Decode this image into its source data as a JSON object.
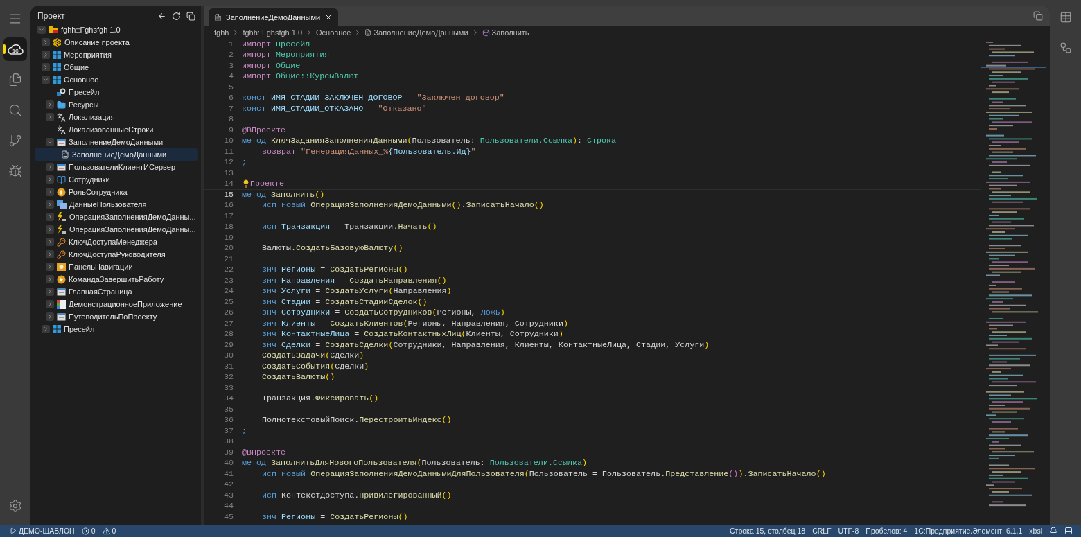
{
  "activity_bar": {
    "items": [
      {
        "kind": "menu",
        "selected": false
      },
      {
        "kind": "cloud",
        "logo_text": "1С",
        "selected": true
      },
      {
        "kind": "files",
        "selected": false
      },
      {
        "kind": "search",
        "selected": false
      },
      {
        "kind": "branch",
        "selected": false
      },
      {
        "kind": "debug",
        "selected": false
      }
    ],
    "bottom": [
      {
        "kind": "settings"
      }
    ]
  },
  "sidebar": {
    "title": "Проект",
    "tree": [
      {
        "label": "fghh::Fghsfgh 1.0",
        "kind": "project",
        "expanded": true,
        "selected": false,
        "children": [
          {
            "label": "Описание проекта",
            "kind": "gear",
            "expanded": false,
            "selected": false
          },
          {
            "label": "Мероприятия",
            "kind": "grid",
            "expanded": false,
            "selected": false
          },
          {
            "label": "Общие",
            "kind": "grid",
            "expanded": false,
            "selected": false
          },
          {
            "label": "Основное",
            "kind": "grid",
            "expanded": true,
            "selected": false,
            "children": [
              {
                "label": "Пресейл",
                "kind": "service",
                "selected": false
              },
              {
                "label": "Ресурсы",
                "kind": "folder",
                "expanded": false,
                "selected": false
              },
              {
                "label": "Локализация",
                "kind": "translate",
                "expanded": false,
                "selected": false
              },
              {
                "label": "ЛокализованныеСтроки",
                "kind": "translate",
                "selected": false
              },
              {
                "label": "ЗаполнениеДемоДанными",
                "kind": "form",
                "expanded": true,
                "selected": false,
                "children": [
                  {
                    "label": "ЗаполнениеДемоДанными",
                    "kind": "doc",
                    "selected": true
                  }
                ]
              },
              {
                "label": "ПользователиКлиентИСервер",
                "kind": "form",
                "expanded": false,
                "selected": false
              },
              {
                "label": "Сотрудники",
                "kind": "book",
                "expanded": false,
                "selected": false
              },
              {
                "label": "РольСотрудника",
                "kind": "coin",
                "expanded": false,
                "selected": false
              },
              {
                "label": "ДанныеПользователя",
                "kind": "table",
                "expanded": false,
                "selected": false
              },
              {
                "label": "ОперацияЗаполненияДемоДанны...",
                "kind": "log",
                "expanded": false,
                "selected": false
              },
              {
                "label": "ОперацияЗаполненияДемоДанны...",
                "kind": "log",
                "expanded": false,
                "selected": false
              },
              {
                "label": "КлючДоступаМенеджера",
                "kind": "key",
                "expanded": false,
                "selected": false
              },
              {
                "label": "КлючДоступаРуководителя",
                "kind": "key",
                "expanded": false,
                "selected": false
              },
              {
                "label": "ПанельНавигации",
                "kind": "nav",
                "expanded": false,
                "selected": false
              },
              {
                "label": "КомандаЗавершитьРаботу",
                "kind": "play",
                "expanded": false,
                "selected": false
              },
              {
                "label": "ГлавнаяСтраница",
                "kind": "page",
                "expanded": false,
                "selected": false
              },
              {
                "label": "ДемонстрационноеПриложение",
                "kind": "app",
                "expanded": false,
                "selected": false
              },
              {
                "label": "ПутеводительПоПроекту",
                "kind": "page",
                "expanded": false,
                "selected": false
              }
            ]
          },
          {
            "label": "Пресейл",
            "kind": "grid",
            "expanded": false,
            "selected": false
          }
        ]
      }
    ]
  },
  "editor": {
    "tabs": [
      {
        "label": "ЗаполнениеДемоДанными",
        "selected": true
      }
    ],
    "breadcrumbs": [
      {
        "label": "fghh",
        "kind": "text"
      },
      {
        "label": "fghh::Fghsfgh 1.0",
        "kind": "text"
      },
      {
        "label": "Основное",
        "kind": "text"
      },
      {
        "label": "ЗаполнениеДемоДанными",
        "kind": "doc"
      },
      {
        "label": "Заполнить",
        "kind": "method"
      }
    ],
    "lines": [
      {
        "n": "1",
        "tokens": [
          {
            "kind": "imp",
            "text": "импорт "
          },
          {
            "kind": "mod",
            "text": "Пресейл"
          }
        ]
      },
      {
        "n": "2",
        "tokens": [
          {
            "kind": "imp",
            "text": "импорт "
          },
          {
            "kind": "mod",
            "text": "Мероприятия"
          }
        ]
      },
      {
        "n": "3",
        "tokens": [
          {
            "kind": "imp",
            "text": "импорт "
          },
          {
            "kind": "mod",
            "text": "Общие"
          }
        ]
      },
      {
        "n": "4",
        "tokens": [
          {
            "kind": "imp",
            "text": "импорт "
          },
          {
            "kind": "mod",
            "text": "Общие::КурсыВалют"
          }
        ]
      },
      {
        "n": "5"
      },
      {
        "n": "6",
        "tokens": [
          {
            "kind": "kw",
            "text": "конст "
          },
          {
            "kind": "var",
            "text": "ИМЯ_СТАДИИ_ЗАКЛЮЧЕН_ДОГОВОР"
          },
          {
            "kind": "p",
            "text": " = "
          },
          {
            "kind": "str",
            "text": "\"Заключен договор\""
          }
        ]
      },
      {
        "n": "7",
        "tokens": [
          {
            "kind": "kw",
            "text": "конст "
          },
          {
            "kind": "var",
            "text": "ИМЯ_СТАДИИ_ОТКАЗАНО"
          },
          {
            "kind": "p",
            "text": " = "
          },
          {
            "kind": "str",
            "text": "\"Отказано\""
          }
        ]
      },
      {
        "n": "8"
      },
      {
        "n": "9",
        "tokens": [
          {
            "kind": "imp",
            "text": "@ВПроекте"
          }
        ]
      },
      {
        "n": "10",
        "tokens": [
          {
            "kind": "kw",
            "text": "метод "
          },
          {
            "kind": "fn",
            "text": "КлючЗаданияЗаполненияДанными"
          },
          {
            "kind": "br",
            "text": "("
          },
          {
            "kind": "p",
            "text": "Пользователь: "
          },
          {
            "kind": "mod",
            "text": "Пользователи.Ссылка"
          },
          {
            "kind": "br",
            "text": ")"
          },
          {
            "kind": "p",
            "text": ": "
          },
          {
            "kind": "mod",
            "text": "Строка"
          }
        ]
      },
      {
        "n": "11",
        "indented": true,
        "tokens": [
          {
            "kind": "imp",
            "text": "возврат "
          },
          {
            "kind": "str",
            "text": "\"ГенерацияДанных_%"
          },
          {
            "kind": "var",
            "text": "{Пользователь.Ид}"
          },
          {
            "kind": "str",
            "text": "\""
          }
        ]
      },
      {
        "n": "12",
        "tokens": [
          {
            "kind": "kw",
            "text": ";"
          }
        ]
      },
      {
        "n": "13"
      },
      {
        "n": "14",
        "bulb": true,
        "tokens": [
          {
            "kind": "imp",
            "text": "Проекте"
          }
        ]
      },
      {
        "n": "15",
        "current": true,
        "tokens": [
          {
            "kind": "kw",
            "text": "метод "
          },
          {
            "kind": "fn",
            "text": "Заполнить"
          },
          {
            "kind": "br",
            "text": "()"
          }
        ]
      },
      {
        "n": "16",
        "indented": true,
        "tokens": [
          {
            "kind": "kw",
            "text": "исп "
          },
          {
            "kind": "kw",
            "text": "новый "
          },
          {
            "kind": "fn",
            "text": "ОперацияЗаполненияДемоДанными"
          },
          {
            "kind": "br",
            "text": "()"
          },
          {
            "kind": "p",
            "text": "."
          },
          {
            "kind": "fn",
            "text": "ЗаписатьНачало"
          },
          {
            "kind": "br",
            "text": "()"
          }
        ]
      },
      {
        "n": "17",
        "indented": true
      },
      {
        "n": "18",
        "indented": true,
        "tokens": [
          {
            "kind": "kw",
            "text": "исп "
          },
          {
            "kind": "var",
            "text": "Транзакция"
          },
          {
            "kind": "p",
            "text": " = Транзакции."
          },
          {
            "kind": "fn",
            "text": "Начать"
          },
          {
            "kind": "br",
            "text": "()"
          }
        ]
      },
      {
        "n": "19",
        "indented": true
      },
      {
        "n": "20",
        "indented": true,
        "tokens": [
          {
            "kind": "p",
            "text": "Валюты."
          },
          {
            "kind": "fn",
            "text": "СоздатьБазовуюВалюту"
          },
          {
            "kind": "br",
            "text": "()"
          }
        ]
      },
      {
        "n": "21",
        "indented": true
      },
      {
        "n": "22",
        "indented": true,
        "tokens": [
          {
            "kind": "kw",
            "text": "знч "
          },
          {
            "kind": "var",
            "text": "Регионы"
          },
          {
            "kind": "p",
            "text": " = "
          },
          {
            "kind": "fn",
            "text": "СоздатьРегионы"
          },
          {
            "kind": "br",
            "text": "()"
          }
        ]
      },
      {
        "n": "23",
        "indented": true,
        "tokens": [
          {
            "kind": "kw",
            "text": "знч "
          },
          {
            "kind": "var",
            "text": "Направления"
          },
          {
            "kind": "p",
            "text": " = "
          },
          {
            "kind": "fn",
            "text": "СоздатьНаправления"
          },
          {
            "kind": "br",
            "text": "()"
          }
        ]
      },
      {
        "n": "24",
        "indented": true,
        "tokens": [
          {
            "kind": "kw",
            "text": "знч "
          },
          {
            "kind": "var",
            "text": "Услуги"
          },
          {
            "kind": "p",
            "text": " = "
          },
          {
            "kind": "fn",
            "text": "СоздатьУслуги"
          },
          {
            "kind": "br",
            "text": "("
          },
          {
            "kind": "p",
            "text": "Направления"
          },
          {
            "kind": "br",
            "text": ")"
          }
        ]
      },
      {
        "n": "25",
        "indented": true,
        "tokens": [
          {
            "kind": "kw",
            "text": "знч "
          },
          {
            "kind": "var",
            "text": "Стадии"
          },
          {
            "kind": "p",
            "text": " = "
          },
          {
            "kind": "fn",
            "text": "СоздатьСтадииСделок"
          },
          {
            "kind": "br",
            "text": "()"
          }
        ]
      },
      {
        "n": "26",
        "indented": true,
        "tokens": [
          {
            "kind": "kw",
            "text": "знч "
          },
          {
            "kind": "var",
            "text": "Сотрудники"
          },
          {
            "kind": "p",
            "text": " = "
          },
          {
            "kind": "fn",
            "text": "СоздатьСотрудников"
          },
          {
            "kind": "br",
            "text": "("
          },
          {
            "kind": "p",
            "text": "Регионы, "
          },
          {
            "kind": "kw",
            "text": "Ложь"
          },
          {
            "kind": "br",
            "text": ")"
          }
        ]
      },
      {
        "n": "27",
        "indented": true,
        "tokens": [
          {
            "kind": "kw",
            "text": "знч "
          },
          {
            "kind": "var",
            "text": "Клиенты"
          },
          {
            "kind": "p",
            "text": " = "
          },
          {
            "kind": "fn",
            "text": "СоздатьКлиентов"
          },
          {
            "kind": "br",
            "text": "("
          },
          {
            "kind": "p",
            "text": "Регионы, Направления, Сотрудники"
          },
          {
            "kind": "br",
            "text": ")"
          }
        ]
      },
      {
        "n": "28",
        "indented": true,
        "tokens": [
          {
            "kind": "kw",
            "text": "знч "
          },
          {
            "kind": "var",
            "text": "КонтактныеЛица"
          },
          {
            "kind": "p",
            "text": " = "
          },
          {
            "kind": "fn",
            "text": "СоздатьКонтактныхЛиц"
          },
          {
            "kind": "br",
            "text": "("
          },
          {
            "kind": "p",
            "text": "Клиенты, Сотрудники"
          },
          {
            "kind": "br",
            "text": ")"
          }
        ]
      },
      {
        "n": "29",
        "indented": true,
        "tokens": [
          {
            "kind": "kw",
            "text": "знч "
          },
          {
            "kind": "var",
            "text": "Сделки"
          },
          {
            "kind": "p",
            "text": " = "
          },
          {
            "kind": "fn",
            "text": "СоздатьСделки"
          },
          {
            "kind": "br",
            "text": "("
          },
          {
            "kind": "p",
            "text": "Сотрудники, Направления, Клиенты, КонтактныеЛица, Стадии, Услуги"
          },
          {
            "kind": "br",
            "text": ")"
          }
        ]
      },
      {
        "n": "30",
        "indented": true,
        "tokens": [
          {
            "kind": "fn",
            "text": "СоздатьЗадачи"
          },
          {
            "kind": "br",
            "text": "("
          },
          {
            "kind": "p",
            "text": "Сделки"
          },
          {
            "kind": "br",
            "text": ")"
          }
        ]
      },
      {
        "n": "31",
        "indented": true,
        "tokens": [
          {
            "kind": "fn",
            "text": "СоздатьСобытия"
          },
          {
            "kind": "br",
            "text": "("
          },
          {
            "kind": "p",
            "text": "Сделки"
          },
          {
            "kind": "br",
            "text": ")"
          }
        ]
      },
      {
        "n": "32",
        "indented": true,
        "tokens": [
          {
            "kind": "fn",
            "text": "СоздатьВалюты"
          },
          {
            "kind": "br",
            "text": "()"
          }
        ]
      },
      {
        "n": "33",
        "indented": true
      },
      {
        "n": "34",
        "indented": true,
        "tokens": [
          {
            "kind": "p",
            "text": "Транзакция."
          },
          {
            "kind": "fn",
            "text": "Фиксировать"
          },
          {
            "kind": "br",
            "text": "()"
          }
        ]
      },
      {
        "n": "35",
        "indented": true
      },
      {
        "n": "36",
        "indented": true,
        "tokens": [
          {
            "kind": "p",
            "text": "ПолнотекстовыйПоиск."
          },
          {
            "kind": "fn",
            "text": "ПерестроитьИндекс"
          },
          {
            "kind": "br",
            "text": "()"
          }
        ]
      },
      {
        "n": "37",
        "tokens": [
          {
            "kind": "kw",
            "text": ";"
          }
        ]
      },
      {
        "n": "38"
      },
      {
        "n": "39",
        "tokens": [
          {
            "kind": "imp",
            "text": "@ВПроекте"
          }
        ]
      },
      {
        "n": "40",
        "tokens": [
          {
            "kind": "kw",
            "text": "метод "
          },
          {
            "kind": "fn",
            "text": "ЗаполнитьДляНовогоПользователя"
          },
          {
            "kind": "br",
            "text": "("
          },
          {
            "kind": "p",
            "text": "Пользователь: "
          },
          {
            "kind": "mod",
            "text": "Пользователи.Ссылка"
          },
          {
            "kind": "br",
            "text": ")"
          }
        ]
      },
      {
        "n": "41",
        "indented": true,
        "tokens": [
          {
            "kind": "kw",
            "text": "исп "
          },
          {
            "kind": "kw",
            "text": "новый "
          },
          {
            "kind": "fn",
            "text": "ОперацияЗаполненияДемоДаннымиДляПользователя"
          },
          {
            "kind": "br",
            "text": "("
          },
          {
            "kind": "p",
            "text": "Пользователь = Пользователь."
          },
          {
            "kind": "fn",
            "text": "Представление"
          },
          {
            "kind": "br2",
            "text": "()"
          },
          {
            "kind": "br",
            "text": ")"
          },
          {
            "kind": "p",
            "text": "."
          },
          {
            "kind": "fn",
            "text": "ЗаписатьНачало"
          },
          {
            "kind": "br",
            "text": "()"
          }
        ]
      },
      {
        "n": "42",
        "indented": true
      },
      {
        "n": "43",
        "indented": true,
        "tokens": [
          {
            "kind": "kw",
            "text": "исп "
          },
          {
            "kind": "p",
            "text": "КонтекстДоступа."
          },
          {
            "kind": "fn",
            "text": "Привилегированный"
          },
          {
            "kind": "br",
            "text": "()"
          }
        ]
      },
      {
        "n": "44",
        "indented": true
      },
      {
        "n": "45",
        "indented": true,
        "tokens": [
          {
            "kind": "kw",
            "text": "знч "
          },
          {
            "kind": "var",
            "text": "Регионы"
          },
          {
            "kind": "p",
            "text": " = "
          },
          {
            "kind": "fn",
            "text": "СоздатьРегионы"
          },
          {
            "kind": "br",
            "text": "()"
          }
        ]
      }
    ]
  },
  "right_bar": {
    "items": [
      {
        "kind": "table"
      },
      {
        "kind": "diagram"
      }
    ]
  },
  "status_bar": {
    "left": [
      {
        "kind": "run",
        "label": "ДЕМО-ШАБЛОН"
      },
      {
        "kind": "errors",
        "label": "0"
      },
      {
        "kind": "warnings",
        "label": "0"
      }
    ],
    "right": [
      {
        "kind": "text",
        "label": "Строка 15, столбец 18"
      },
      {
        "kind": "text",
        "label": "CRLF"
      },
      {
        "kind": "text",
        "label": "UTF-8"
      },
      {
        "kind": "text",
        "label": "Пробелов: 4"
      },
      {
        "kind": "text",
        "label": "1С:Предприятие.Элемент: 6.1.1"
      },
      {
        "kind": "text",
        "label": "xbsl"
      },
      {
        "kind": "bell"
      },
      {
        "kind": "panel"
      }
    ]
  }
}
